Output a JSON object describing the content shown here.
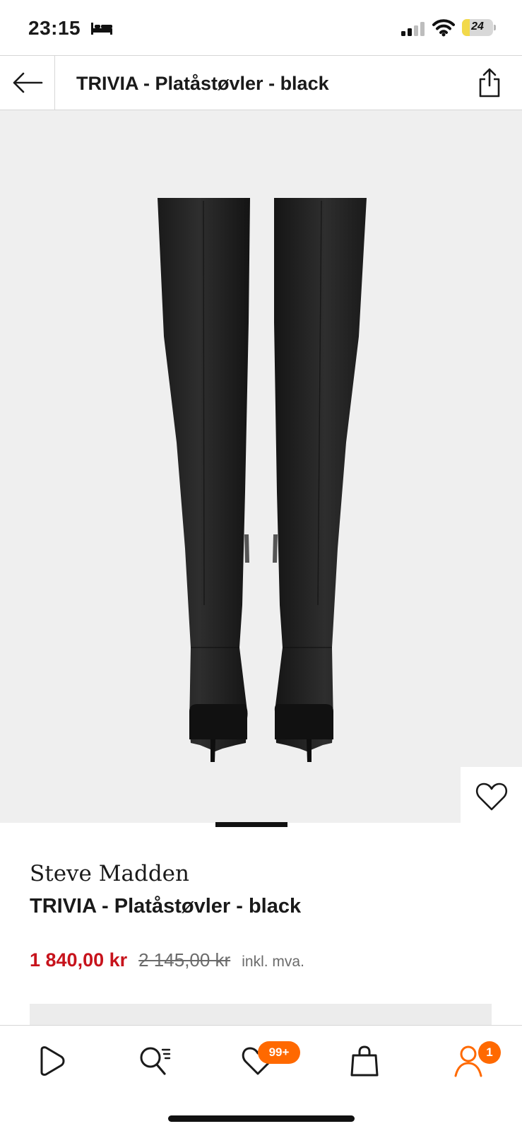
{
  "status_bar": {
    "time": "23:15",
    "battery_level": "24",
    "battery_fraction": 0.24,
    "icons": [
      "bed-icon",
      "signal-icon",
      "wifi-icon",
      "battery-icon"
    ]
  },
  "header": {
    "title": "TRIVIA - Platåstøvler - black",
    "back_icon": "arrow-left-icon",
    "share_icon": "share-icon"
  },
  "gallery": {
    "wishlist_icon": "heart-icon",
    "background_color": "#efefef"
  },
  "product": {
    "brand": "Steve Madden",
    "name": "TRIVIA - Platåstøvler - black",
    "price_current": "1 840,00 kr",
    "price_original": "2 145,00 kr",
    "price_note": "inkl. mva."
  },
  "bottom_nav": {
    "items": [
      {
        "icon": "play-logo-icon"
      },
      {
        "icon": "search-list-icon"
      },
      {
        "icon": "heart-icon",
        "badge": "99+"
      },
      {
        "icon": "shopping-bag-icon"
      },
      {
        "icon": "account-icon",
        "badge": "1"
      }
    ]
  },
  "colors": {
    "accent": "#ff6900",
    "sale_price": "#c7131c",
    "text": "#1a1a1a",
    "muted": "#6b6b6b"
  }
}
